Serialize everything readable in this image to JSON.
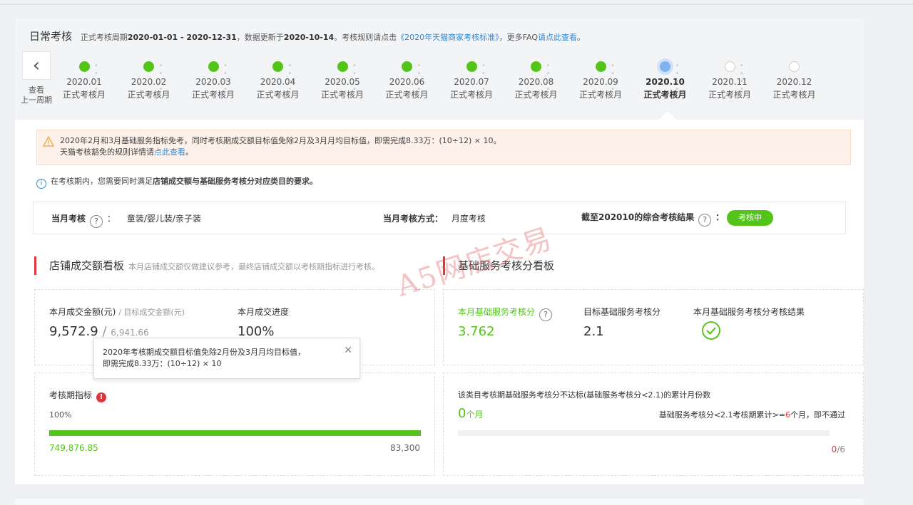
{
  "header": {
    "title": "日常考核",
    "period_text_1": "正式考核周期",
    "period_range": "2020-01-01 - 2020-12-31",
    "period_text_2": "，数据更新于",
    "update_date": "2020-10-14",
    "period_text_3": "。考核规则请点击",
    "rules_link": "《2020年天猫商家考核标准》",
    "faq_text": "，更多FAQ",
    "faq_link": "请点此查看",
    "period_end": "。"
  },
  "timeline": {
    "back_label_1": "查看",
    "back_label_2": "上一周期",
    "months": [
      {
        "month": "2020.01",
        "type": "正式考核月",
        "status": "done"
      },
      {
        "month": "2020.02",
        "type": "正式考核月",
        "status": "done"
      },
      {
        "month": "2020.03",
        "type": "正式考核月",
        "status": "done"
      },
      {
        "month": "2020.04",
        "type": "正式考核月",
        "status": "done"
      },
      {
        "month": "2020.05",
        "type": "正式考核月",
        "status": "done"
      },
      {
        "month": "2020.06",
        "type": "正式考核月",
        "status": "done"
      },
      {
        "month": "2020.07",
        "type": "正式考核月",
        "status": "done"
      },
      {
        "month": "2020.08",
        "type": "正式考核月",
        "status": "done"
      },
      {
        "month": "2020.09",
        "type": "正式考核月",
        "status": "done"
      },
      {
        "month": "2020.10",
        "type": "正式考核月",
        "status": "current"
      },
      {
        "month": "2020.11",
        "type": "正式考核月",
        "status": "future"
      },
      {
        "month": "2020.12",
        "type": "正式考核月",
        "status": "future"
      }
    ]
  },
  "notice": {
    "line1": "2020年2月和3月基础服务指标免考，同时考核期成交额目标值免除2月及3月月均目标值，即需完成8.33万：(10÷12) × 10。",
    "line2_prefix": "天猫考核豁免的规则详情请",
    "line2_link": "点此查看",
    "line2_suffix": "。",
    "warn_color": "#f0a23b"
  },
  "info": {
    "prefix": "在考核期内，您需要同时满足",
    "bold": "店铺成交额与基础服务考核分对应类目的要求。"
  },
  "assessment": {
    "month_label": "当月考核",
    "month_colon": "：",
    "category": "童装/婴儿装/亲子装",
    "method_label": "当月考核方式：",
    "method_value": "月度考核",
    "result_label": "截至202010的综合考核结果",
    "result_colon": "：",
    "result_badge": "考核中"
  },
  "sales_board": {
    "title": "店铺成交额看板",
    "note": "本月店铺成交额仅做建议参考，最终店铺成交额以考核期指标进行考核。",
    "sales_label": "本月成交金额(元)",
    "target_label": "/ 目标成交金额(元)",
    "sales_value": "9,572.9",
    "slash": "/",
    "target_value": "6,941.66",
    "progress_label": "本月成交进度",
    "progress_value": "100%",
    "tooltip_line1": "2020年考核期成交额目标值免除2月份及3月月均目标值，",
    "tooltip_line2": "即需完成8.33万：(10÷12) × 10",
    "period_label": "考核期指标",
    "period_percent": "100%",
    "period_progress": 1.0,
    "period_current": "749,876.85",
    "period_target": "83,300"
  },
  "service_board": {
    "title": "基础服务考核分看板",
    "score_label": "本月基础服务考核分",
    "score_value": "3.762",
    "target_label": "目标基础服务考核分",
    "target_value": "2.1",
    "result_label": "本月基础服务考核分考核结果",
    "fail_title": "该类目考核期基础服务考核分不达标(基础服务考核分<2.1)的累计月份数",
    "fail_count": "0",
    "fail_unit": "个月",
    "rule_prefix": "基础服务考核分<2.1考核期累计>=",
    "rule_num": "6",
    "rule_suffix": "个月，即不通过",
    "fail_ratio_num": "0",
    "fail_ratio_den": "/6",
    "fail_progress": 0
  },
  "watermark": "A5网店交易",
  "colors": {
    "green": "#52c41a",
    "red": "#e0353b",
    "blue": "#2f88d8"
  }
}
